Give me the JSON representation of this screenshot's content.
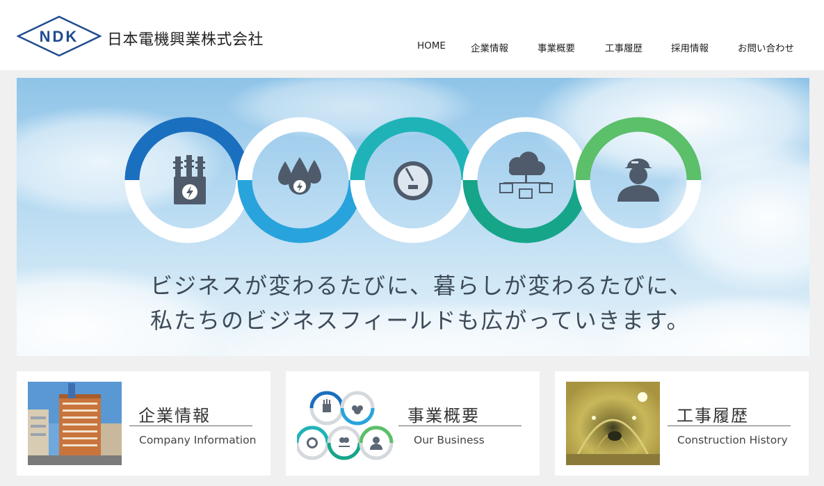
{
  "brand": {
    "logo_mark": "NDK",
    "company_name": "日本電機興業株式会社",
    "accent_color": "#1e4b8f"
  },
  "nav": {
    "items": [
      {
        "label": "HOME"
      },
      {
        "label": "企業情報"
      },
      {
        "label": "事業概要"
      },
      {
        "label": "工事履歴"
      },
      {
        "label": "採用情報"
      },
      {
        "label": "お問い合わせ"
      }
    ]
  },
  "hero": {
    "tagline_line1": "ビジネスが変わるたびに、暮らしが変わるたびに、",
    "tagline_line2": "私たちのビジネスフィールドも広がっていきます。",
    "rings": [
      {
        "icon": "transformer-icon",
        "color": "#1a6fbf"
      },
      {
        "icon": "power-drops-icon",
        "color": "#29a3dc"
      },
      {
        "icon": "gauge-icon",
        "color": "#1fb3b8"
      },
      {
        "icon": "cloud-network-icon",
        "color": "#17a58a"
      },
      {
        "icon": "worker-icon",
        "color": "#5cbf6a"
      }
    ]
  },
  "cards": [
    {
      "title": "企業情報",
      "subtitle": "Company Information",
      "thumb": "building-photo"
    },
    {
      "title": "事業概要",
      "subtitle": "Our Business",
      "thumb": "business-rings"
    },
    {
      "title": "工事履歴",
      "subtitle": "Construction History",
      "thumb": "tunnel-photo"
    }
  ]
}
